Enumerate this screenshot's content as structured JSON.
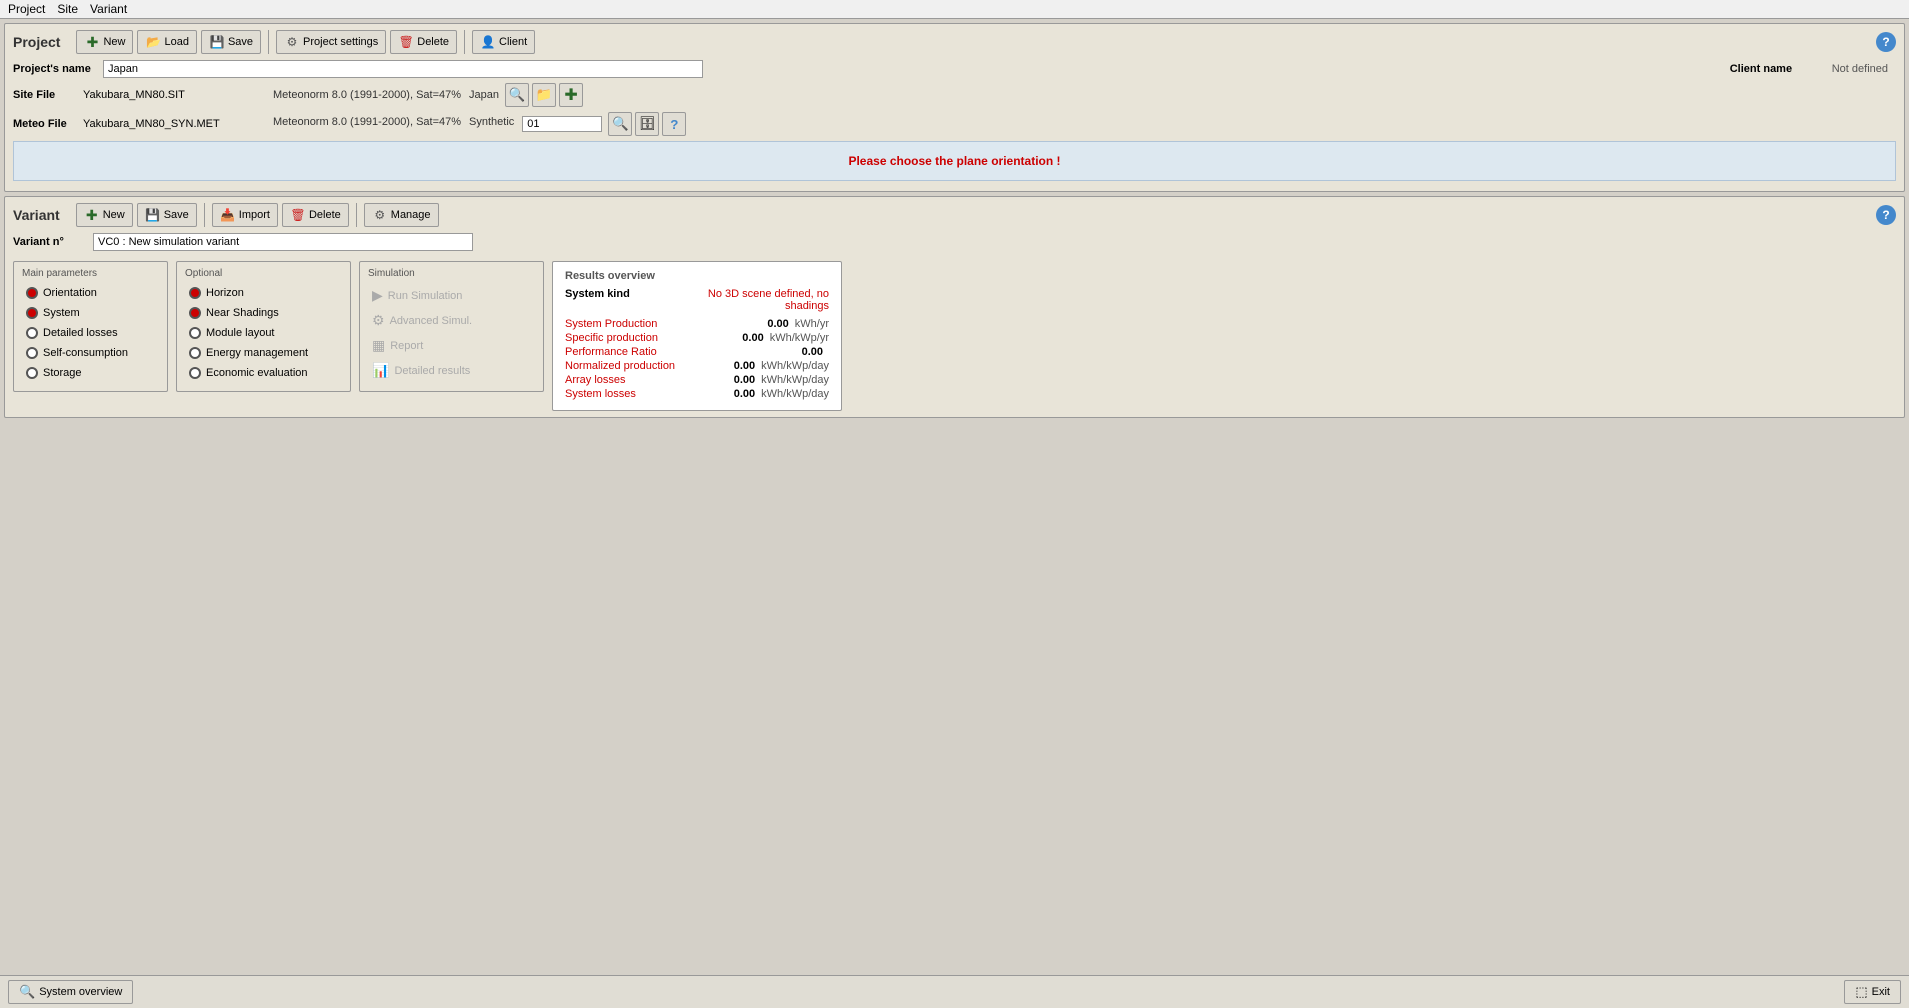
{
  "menu": {
    "items": [
      "Project",
      "Site",
      "Variant"
    ]
  },
  "header": {
    "title": "Project",
    "help_label": "?"
  },
  "project_toolbar": {
    "new_label": "New",
    "load_label": "Load",
    "save_label": "Save",
    "settings_label": "Project settings",
    "delete_label": "Delete",
    "client_label": "Client"
  },
  "project_fields": {
    "name_label": "Project's name",
    "name_value": "Japan",
    "client_name_label": "Client name",
    "client_name_value": "Not defined",
    "site_file_label": "Site File",
    "site_file_name": "Yakubara_MN80.SIT",
    "site_file_meta1": "Meteonorm 8.0 (1991-2000), Sat=47%",
    "site_file_meta2": "Japan",
    "meteo_file_label": "Meteo File",
    "meteo_file_name": "Yakubara_MN80_SYN.MET",
    "meteo_file_meta1": "Meteonorm 8.0 (1991-2000), Sat=47%",
    "meteo_file_meta2": "Synthetic",
    "meteo_file_option": "01"
  },
  "info_message": "Please choose the plane orientation !",
  "variant": {
    "title": "Variant",
    "new_label": "New",
    "save_label": "Save",
    "import_label": "Import",
    "delete_label": "Delete",
    "manage_label": "Manage",
    "variant_label": "Variant n°",
    "variant_value": "VC0    : New simulation variant",
    "help_label": "?"
  },
  "main_params": {
    "title": "Main parameters",
    "items": [
      {
        "label": "Orientation",
        "state": "filled"
      },
      {
        "label": "System",
        "state": "filled"
      },
      {
        "label": "Detailed losses",
        "state": "empty"
      },
      {
        "label": "Self-consumption",
        "state": "empty"
      },
      {
        "label": "Storage",
        "state": "empty"
      }
    ]
  },
  "optional_params": {
    "title": "Optional",
    "items": [
      {
        "label": "Horizon",
        "state": "filled"
      },
      {
        "label": "Near Shadings",
        "state": "filled"
      },
      {
        "label": "Module layout",
        "state": "empty"
      },
      {
        "label": "Energy management",
        "state": "empty"
      },
      {
        "label": "Economic evaluation",
        "state": "empty"
      }
    ]
  },
  "simulation": {
    "title": "Simulation",
    "buttons": [
      {
        "label": "Run Simulation",
        "active": false,
        "icon": "▶"
      },
      {
        "label": "Advanced Simul.",
        "active": false,
        "icon": "⚙"
      },
      {
        "label": "Report",
        "active": false,
        "icon": "📄"
      },
      {
        "label": "Detailed results",
        "active": false,
        "icon": "📊"
      }
    ]
  },
  "results": {
    "title": "Results overview",
    "system_kind_label": "System kind",
    "system_kind_value": "No 3D scene defined, no shadings",
    "rows": [
      {
        "label": "System Production",
        "value": "0.00",
        "unit": "kWh/yr"
      },
      {
        "label": "Specific production",
        "value": "0.00",
        "unit": "kWh/kWp/yr"
      },
      {
        "label": "Performance Ratio",
        "value": "0.00",
        "unit": ""
      },
      {
        "label": "Normalized production",
        "value": "0.00",
        "unit": "kWh/kWp/day"
      },
      {
        "label": "Array losses",
        "value": "0.00",
        "unit": "kWh/kWp/day"
      },
      {
        "label": "System losses",
        "value": "0.00",
        "unit": "kWh/kWp/day"
      }
    ]
  },
  "bottom": {
    "system_overview_label": "System overview",
    "exit_label": "Exit"
  },
  "colors": {
    "accent": "#cc0000",
    "toolbar_bg": "#e8e4d8",
    "section_bg": "#d4d0c8"
  }
}
